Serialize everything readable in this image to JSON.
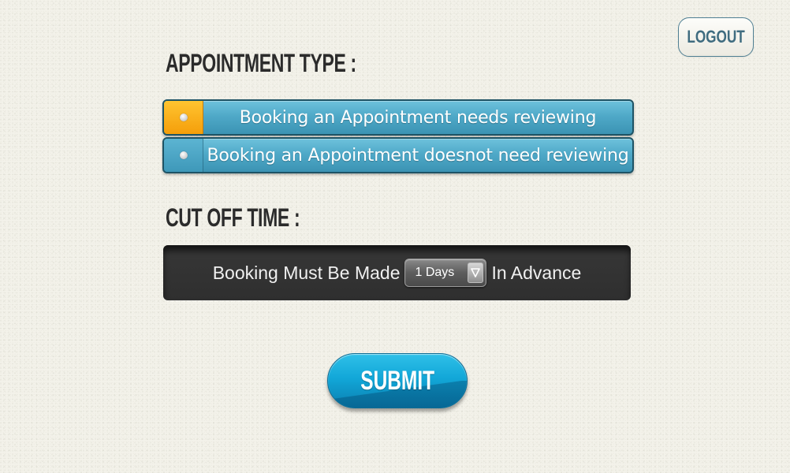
{
  "header": {
    "logout_label": "LOGOUT"
  },
  "appointment_type": {
    "title": "APPOINTMENT TYPE :",
    "options": [
      {
        "label": "Booking an Appointment needs reviewing",
        "selected": true
      },
      {
        "label": "Booking an Appointment doesnot need reviewing",
        "selected": false
      }
    ]
  },
  "cut_off_time": {
    "title": "CUT OFF TIME :",
    "prefix": "Booking Must Be Made",
    "select_value": "1 Days",
    "suffix": "In Advance"
  },
  "submit_label": "SUBMIT",
  "colors": {
    "option_blue": "#4fa9c8",
    "selected_orange": "#f5a516",
    "bar_dark": "#2f2f2f",
    "submit_blue": "#12a7d8",
    "logout_text": "#3f6c80"
  }
}
